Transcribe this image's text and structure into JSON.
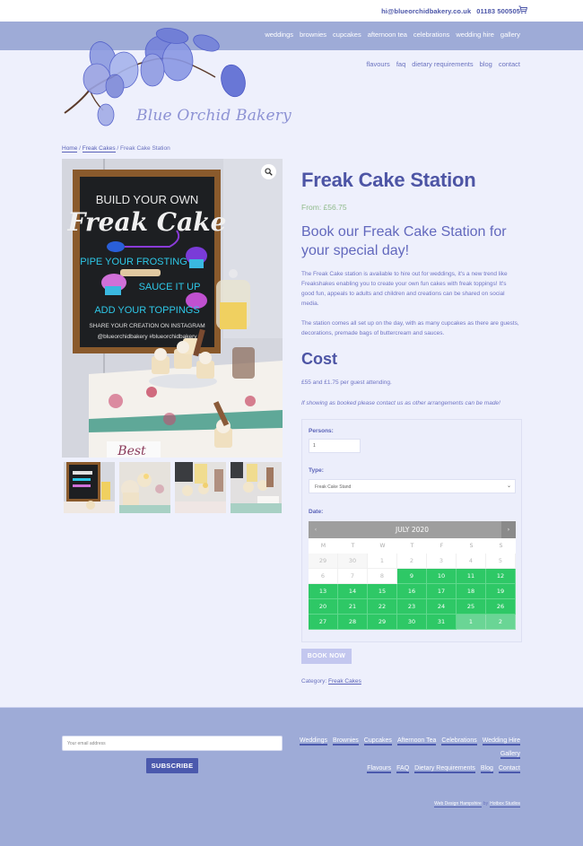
{
  "topbar": {
    "email": "hi@blueorchidbakery.co.uk",
    "phone": "01183 500505",
    "cart_icon": "cart-icon"
  },
  "nav": {
    "main": [
      "weddings",
      "brownies",
      "cupcakes",
      "afternoon tea",
      "celebrations",
      "wedding hire",
      "gallery"
    ],
    "secondary": [
      "flavours",
      "faq",
      "dietary requirements",
      "blog",
      "contact"
    ]
  },
  "logo": {
    "text": "Blue Orchid Bakery"
  },
  "breadcrumb": {
    "home": "Home",
    "sep1": " / ",
    "category": "Freak Cakes",
    "sep2": " / ",
    "current": "Freak Cake Station"
  },
  "gallery": {
    "zoom_icon": "magnifier-icon",
    "main_image_alt": "Build your own Freak Cake chalkboard with cupcakes",
    "sign_lines": [
      "BUILD YOUR OWN",
      "Freak Cake",
      "PIPE YOUR FROSTING",
      "SAUCE IT UP",
      "ADD YOUR TOPPINGS",
      "SHARE YOUR CREATION ON INSTAGRAM",
      "@blueorchidbakery #blueorchidbakery"
    ],
    "thumb_count": 4
  },
  "product": {
    "title": "Freak Cake Station",
    "price": "From: £56.75",
    "tagline": "Book our Freak Cake Station for your special day!",
    "description": [
      "The Freak Cake station is available to hire out for weddings, it's a new trend like Freakshakes enabling you to create your own fun cakes with freak toppings! It's good fun, appeals to adults and children and creations can be shared on social media.",
      "The station comes all set up on the day, with as many cupcakes as there are guests, decorations, premade bags of buttercream and sauces."
    ],
    "cost_title": "Cost",
    "cost_text": "£55 and  £1.75 per guest attending.",
    "note": "If showing as booked please contact us as other arrangements can be made!"
  },
  "booking": {
    "persons_label": "Persons:",
    "persons_value": "1",
    "type_label": "Type:",
    "type_value": "Freak Cake Stand",
    "date_label": "Date:",
    "calendar": {
      "month": "JULY 2020",
      "prev": "‹",
      "next": "›",
      "weekdays": [
        "M",
        "T",
        "W",
        "T",
        "F",
        "S",
        "S"
      ],
      "days": [
        {
          "d": "29",
          "s": "other"
        },
        {
          "d": "30",
          "s": "other"
        },
        {
          "d": "1",
          "s": "off"
        },
        {
          "d": "2",
          "s": "off"
        },
        {
          "d": "3",
          "s": "off"
        },
        {
          "d": "4",
          "s": "off"
        },
        {
          "d": "5",
          "s": "off"
        },
        {
          "d": "6",
          "s": "off"
        },
        {
          "d": "7",
          "s": "off"
        },
        {
          "d": "8",
          "s": "off"
        },
        {
          "d": "9",
          "s": "avail"
        },
        {
          "d": "10",
          "s": "avail"
        },
        {
          "d": "11",
          "s": "avail"
        },
        {
          "d": "12",
          "s": "avail"
        },
        {
          "d": "13",
          "s": "avail"
        },
        {
          "d": "14",
          "s": "avail"
        },
        {
          "d": "15",
          "s": "avail"
        },
        {
          "d": "16",
          "s": "avail"
        },
        {
          "d": "17",
          "s": "avail"
        },
        {
          "d": "18",
          "s": "avail"
        },
        {
          "d": "19",
          "s": "avail"
        },
        {
          "d": "20",
          "s": "avail"
        },
        {
          "d": "21",
          "s": "avail"
        },
        {
          "d": "22",
          "s": "avail"
        },
        {
          "d": "23",
          "s": "avail"
        },
        {
          "d": "24",
          "s": "avail"
        },
        {
          "d": "25",
          "s": "avail"
        },
        {
          "d": "26",
          "s": "avail"
        },
        {
          "d": "27",
          "s": "avail"
        },
        {
          "d": "28",
          "s": "avail"
        },
        {
          "d": "29",
          "s": "avail"
        },
        {
          "d": "30",
          "s": "avail"
        },
        {
          "d": "31",
          "s": "avail"
        },
        {
          "d": "1",
          "s": "avail-next"
        },
        {
          "d": "2",
          "s": "avail-next"
        }
      ]
    },
    "book_button": "BOOK NOW"
  },
  "category": {
    "label": "Category: ",
    "link": "Freak Cakes"
  },
  "footer": {
    "email_placeholder": "Your email address",
    "subscribe": "SUBSCRIBE",
    "links_row1": [
      "Weddings",
      "Brownies",
      "Cupcakes",
      "Afternoon Tea",
      "Celebrations",
      "Wedding Hire"
    ],
    "links_row2": [
      "Gallery"
    ],
    "links_row3": [
      "Flavours",
      "FAQ",
      "Dietary Requirements",
      "Blog",
      "Contact"
    ],
    "credit_link": "Web Design Hampshire",
    "credit_by": "by",
    "credit_company": "Hotbox Studios"
  },
  "colors": {
    "nav_bg": "#9eabd7",
    "page_bg": "#eef0fc",
    "heading": "#4d55a5",
    "price": "#8fba8a",
    "available_day": "#2ec866",
    "subscribe_bg": "#4b59ad",
    "book_btn_bg": "#c3c7ef"
  }
}
